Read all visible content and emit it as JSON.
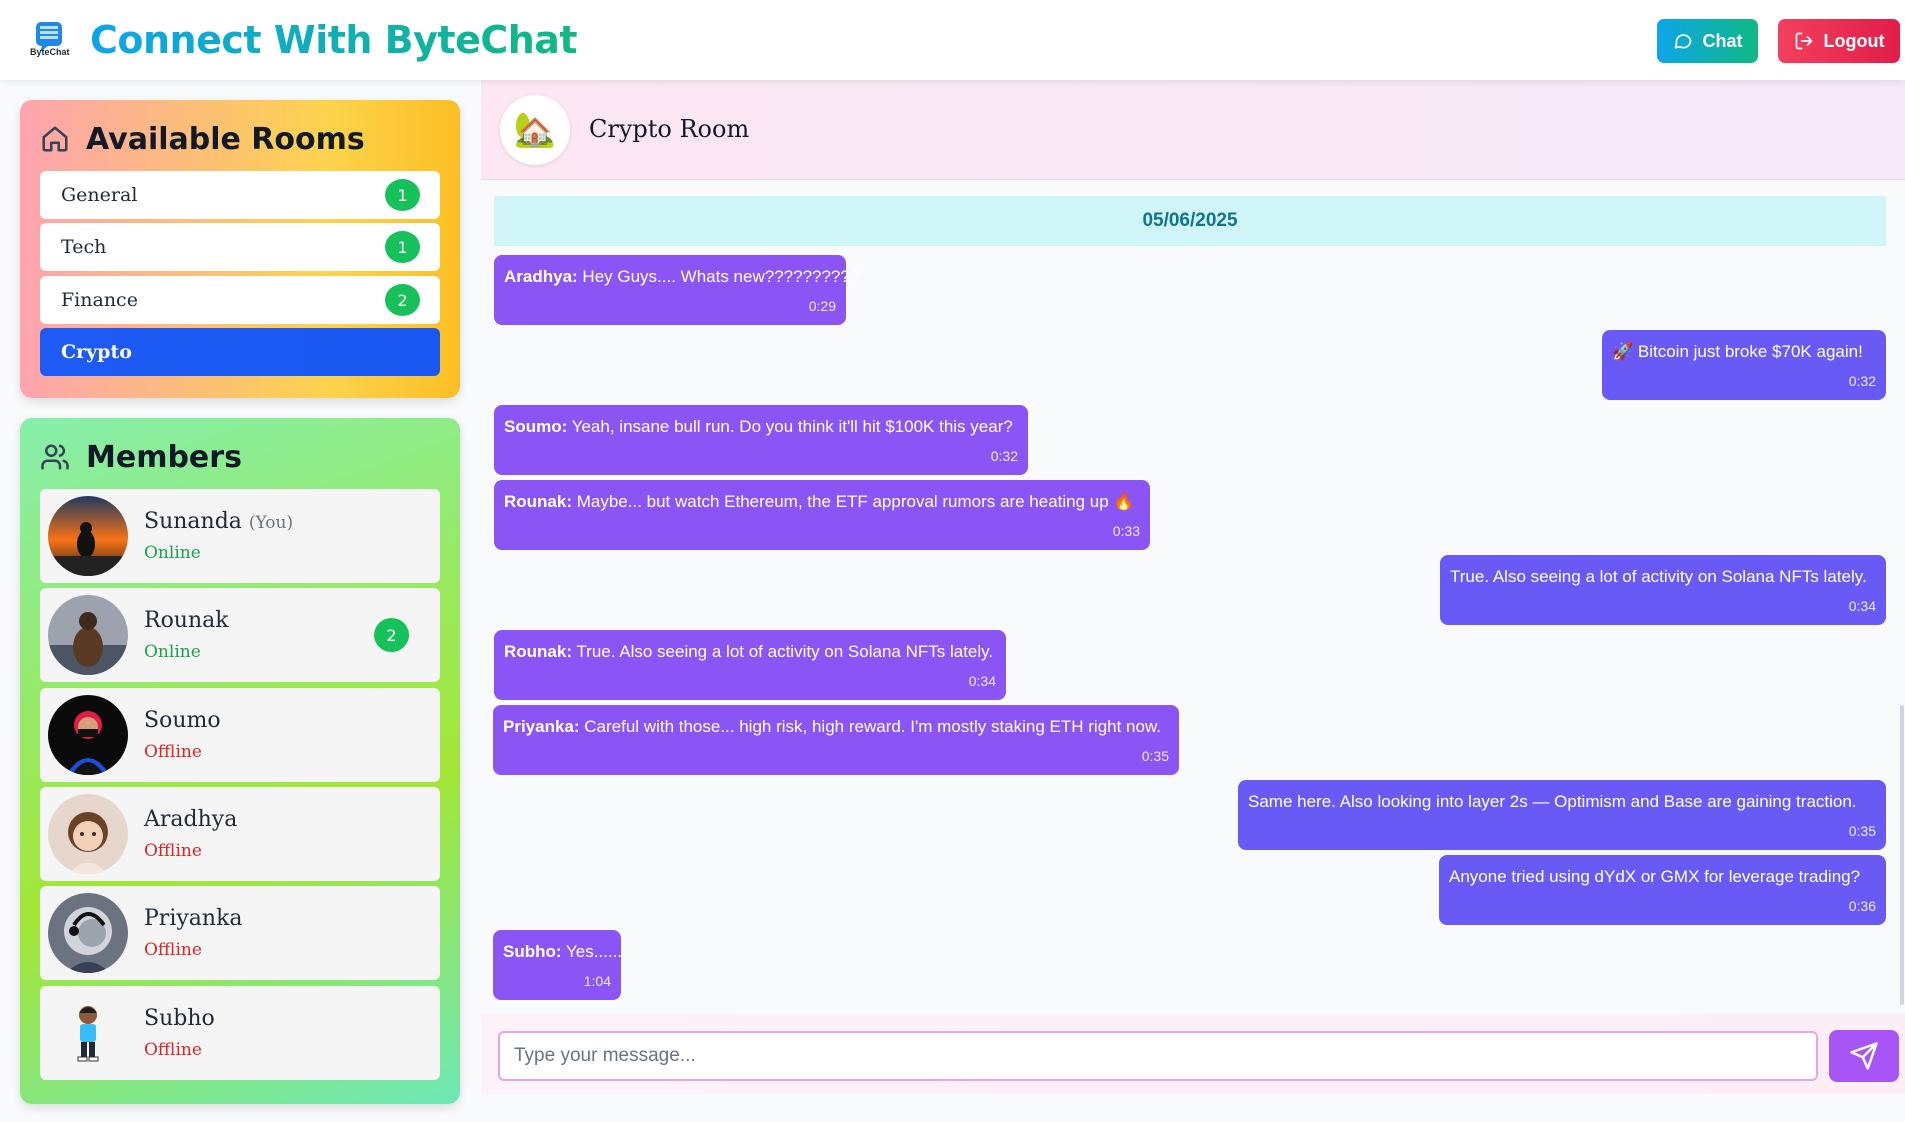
{
  "header": {
    "logo_text": "ByteChat",
    "title": "Connect With ByteChat",
    "chat_label": "Chat",
    "logout_label": "Logout"
  },
  "rooms": {
    "title": "Available Rooms",
    "items": [
      {
        "label": "General",
        "badge": "1"
      },
      {
        "label": "Tech",
        "badge": "1"
      },
      {
        "label": "Finance",
        "badge": "2"
      },
      {
        "label": "Crypto",
        "badge": ""
      }
    ]
  },
  "members": {
    "title": "Members",
    "you_label": "(You)",
    "items": [
      {
        "name": "Sunanda",
        "status": "Online",
        "badge": ""
      },
      {
        "name": "Rounak",
        "status": "Online",
        "badge": "2"
      },
      {
        "name": "Soumo",
        "status": "Offline",
        "badge": ""
      },
      {
        "name": "Aradhya",
        "status": "Offline",
        "badge": ""
      },
      {
        "name": "Priyanka",
        "status": "Offline",
        "badge": ""
      },
      {
        "name": "Subho",
        "status": "Offline",
        "badge": ""
      }
    ]
  },
  "chat": {
    "room_icon": "🏡",
    "room_name": "Crypto Room",
    "date": "05/06/2025",
    "messages": [
      {
        "sender": "Aradhya:",
        "text": " Hey Guys.... Whats new??????????",
        "time": "0:29"
      },
      {
        "sender": "",
        "text": "🚀 Bitcoin just broke $70K again!",
        "time": "0:32"
      },
      {
        "sender": "Soumo:",
        "text": " Yeah, insane bull run. Do you think it'll hit $100K this year?",
        "time": "0:32"
      },
      {
        "sender": "Rounak:",
        "text": " Maybe... but watch Ethereum, the ETF approval rumors are heating up 🔥",
        "time": "0:33"
      },
      {
        "sender": "",
        "text": "True. Also seeing a lot of activity on Solana NFTs lately.",
        "time": "0:34"
      },
      {
        "sender": "Rounak:",
        "text": " True. Also seeing a lot of activity on Solana NFTs lately.",
        "time": "0:34"
      },
      {
        "sender": "Priyanka:",
        "text": " Careful with those... high risk, high reward. I'm mostly staking ETH right now.",
        "time": "0:35"
      },
      {
        "sender": "",
        "text": "Same here. Also looking into layer 2s — Optimism and Base are gaining traction.",
        "time": "0:35"
      },
      {
        "sender": "",
        "text": "Anyone tried using dYdX or GMX for leverage trading?",
        "time": "0:36"
      },
      {
        "sender": "Subho:",
        "text": " Yes......",
        "time": "1:04"
      }
    ],
    "input_placeholder": "Type your message..."
  },
  "colors": {
    "active_room": "#1e5bf5",
    "badge": "#16c15a",
    "bubble_received": "#8b55f6",
    "bubble_sent": "#6a5af5",
    "online": "#16a34a",
    "offline": "#dc2626"
  }
}
